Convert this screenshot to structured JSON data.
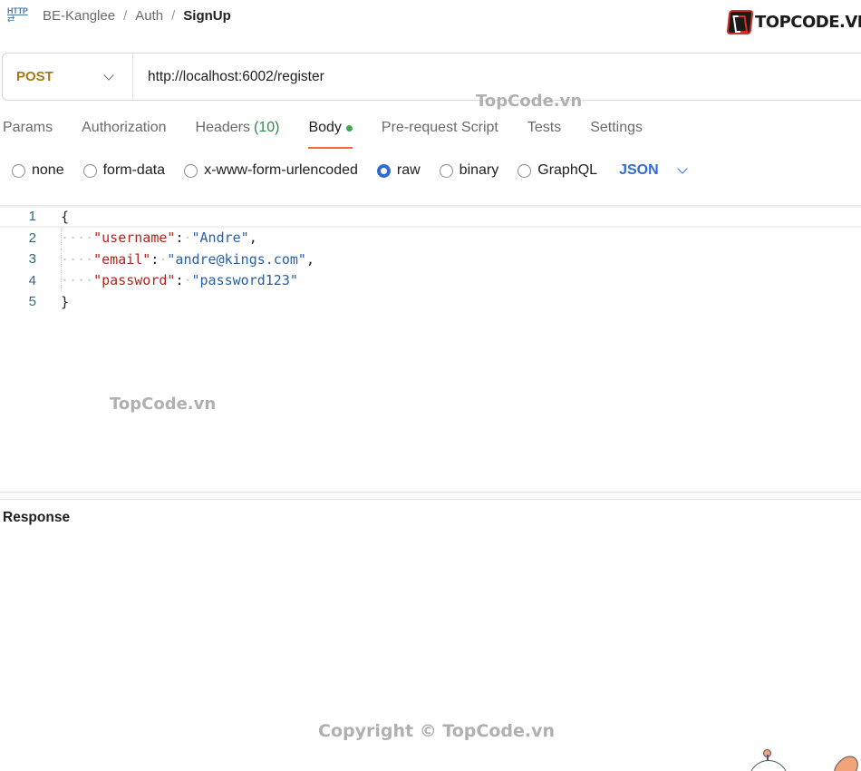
{
  "breadcrumb": {
    "icon_label": "HTTP",
    "items": [
      "BE-Kanglee",
      "Auth",
      "SignUp"
    ],
    "separator": "/"
  },
  "brand": {
    "text": "TOPCODE.VN"
  },
  "request": {
    "method": "POST",
    "method_color": "#a47a14",
    "url": "http://localhost:6002/register"
  },
  "tabs": [
    {
      "label": "Params"
    },
    {
      "label": "Authorization"
    },
    {
      "label": "Headers",
      "count": "(10)"
    },
    {
      "label": "Body",
      "active": true,
      "indicator": "green-dot"
    },
    {
      "label": "Pre-request Script"
    },
    {
      "label": "Tests"
    },
    {
      "label": "Settings"
    }
  ],
  "body_types": {
    "options": [
      "none",
      "form-data",
      "x-www-form-urlencoded",
      "raw",
      "binary",
      "GraphQL"
    ],
    "selected": "raw",
    "format": "JSON",
    "accent_color": "#2f6bd1"
  },
  "editor": {
    "lines": [
      {
        "num": "1",
        "text": "{"
      },
      {
        "num": "2",
        "key": "\"username\"",
        "value": "\"Andre\"",
        "trail": ","
      },
      {
        "num": "3",
        "key": "\"email\"",
        "value": "\"andre@kings.com\"",
        "trail": ","
      },
      {
        "num": "4",
        "key": "\"password\"",
        "value": "\"password123\"",
        "trail": ""
      },
      {
        "num": "5",
        "text": "}"
      }
    ]
  },
  "response": {
    "label": "Response"
  },
  "watermarks": {
    "top": "TopCode.vn",
    "middle": "TopCode.vn",
    "bottom": "Copyright © TopCode.vn"
  }
}
